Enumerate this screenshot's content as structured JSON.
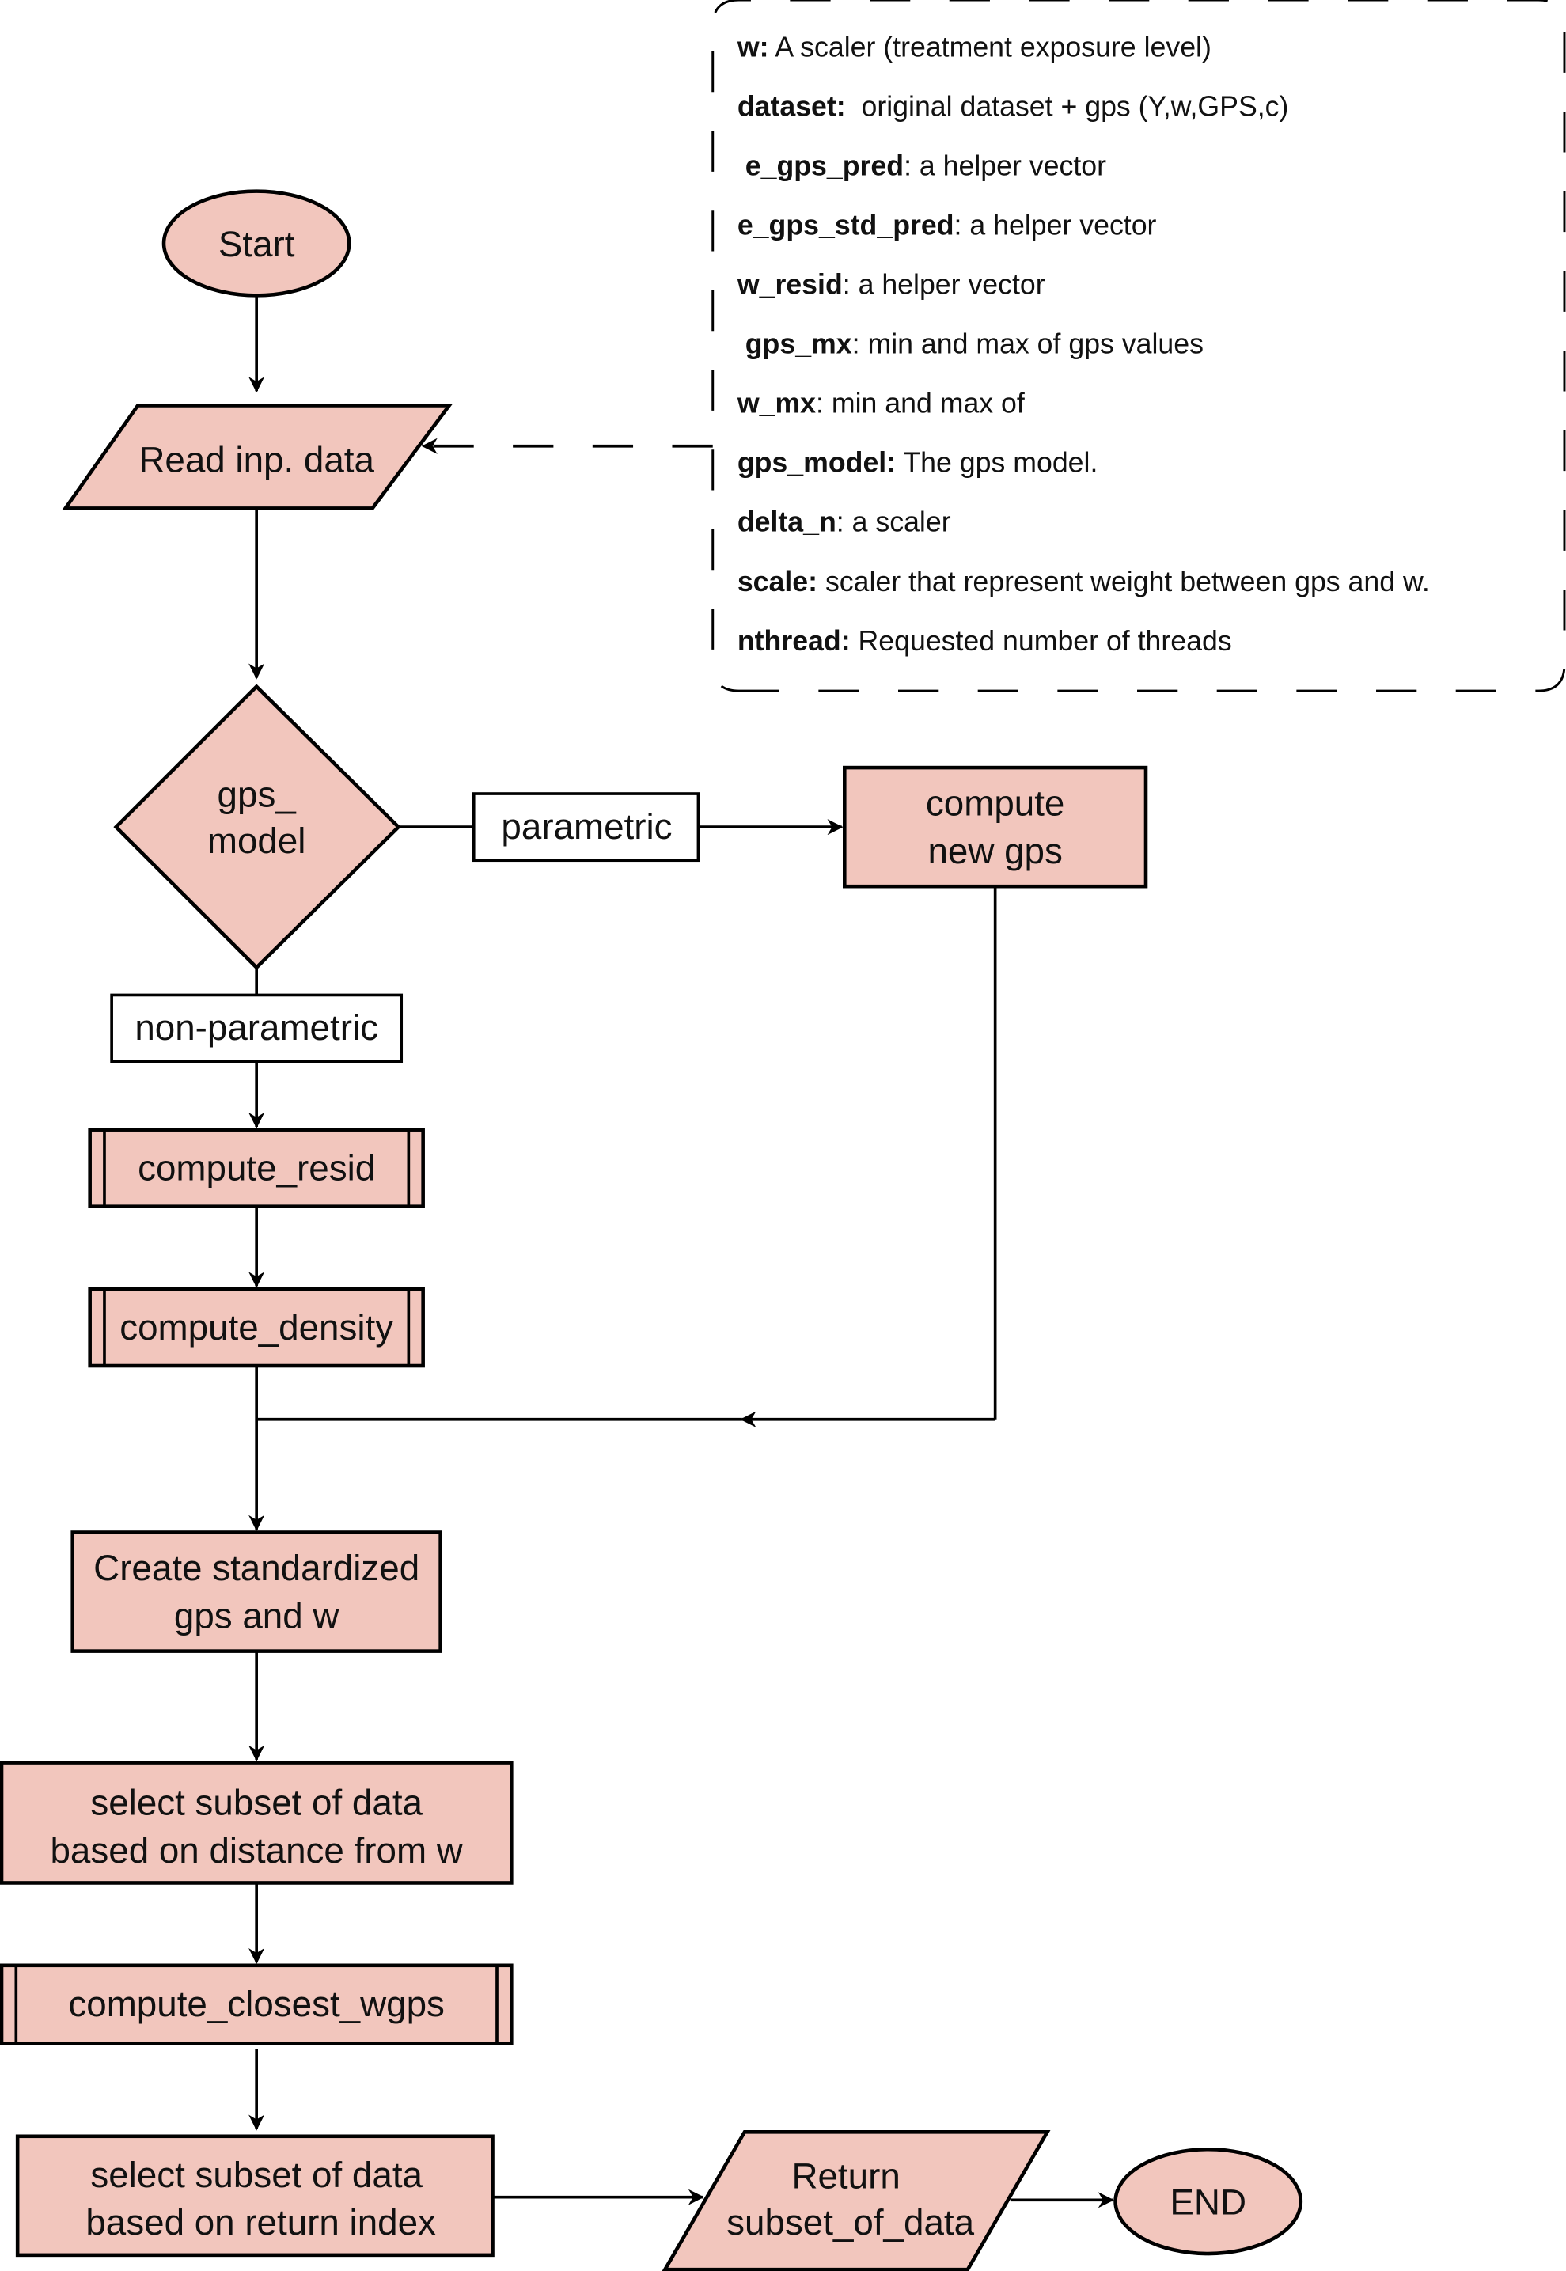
{
  "flowchart": {
    "start": "Start",
    "read_input": "Read inp. data",
    "decision": [
      "gps_",
      "model"
    ],
    "branch_parametric": "parametric",
    "branch_nonparametric": "non-parametric",
    "compute_new_gps": [
      "compute",
      "new gps"
    ],
    "compute_resid": "compute_resid",
    "compute_density": "compute_density",
    "create_standardized": [
      "Create standardized",
      "gps and w"
    ],
    "select_subset_distance": [
      "select subset of data",
      "based on distance from w"
    ],
    "compute_closest_wgps": "compute_closest_wgps",
    "select_subset_index": [
      "select subset of data",
      "based on return index"
    ],
    "return_output": [
      "Return",
      "subset_of_data"
    ],
    "end": "END",
    "colors": {
      "node_fill": "#f2c6bd",
      "stroke": "#000000",
      "label_fill": "#ffffff"
    }
  },
  "legend": [
    {
      "term": "w:",
      "desc": " A scaler (treatment exposure level)"
    },
    {
      "term": "dataset:",
      "desc": "  original dataset + gps (Y,w,GPS,c)"
    },
    {
      "term": " e_gps_pred",
      "desc": ": a helper vector"
    },
    {
      "term": "e_gps_std_pred",
      "desc": ": a helper vector"
    },
    {
      "term": "w_resid",
      "desc": ": a helper vector"
    },
    {
      "term": " gps_mx",
      "desc": ": min and max of gps values"
    },
    {
      "term": "w_mx",
      "desc": ": min and max of"
    },
    {
      "term": "gps_model:",
      "desc": " The gps model."
    },
    {
      "term": "delta_n",
      "desc": ": a scaler"
    },
    {
      "term": "scale:",
      "desc": " scaler that represent weight between gps and w."
    },
    {
      "term": "nthread:",
      "desc": " Requested number of threads"
    }
  ]
}
